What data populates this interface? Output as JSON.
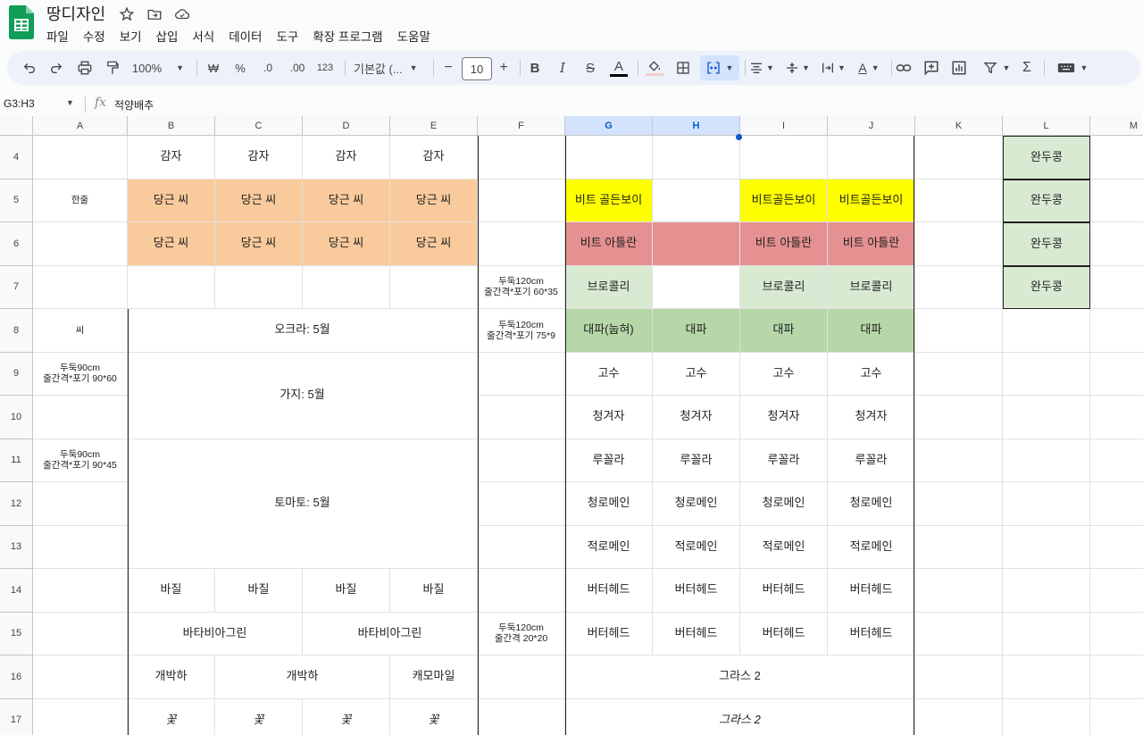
{
  "app": {
    "title": "땅디자인",
    "menus": [
      "파일",
      "수정",
      "보기",
      "삽입",
      "서식",
      "데이터",
      "도구",
      "확장 프로그램",
      "도움말"
    ]
  },
  "toolbar": {
    "zoom": "100%",
    "currency": "₩",
    "percent": "%",
    "dec_decrease": ".0",
    "dec_increase": ".00",
    "format_123": "123",
    "font": "기본값 (...",
    "font_size": "10",
    "minus": "−",
    "plus": "+",
    "bold": "B",
    "italic": "I",
    "strike": "S",
    "text_color": "A",
    "text_color_value": "#000000",
    "fill_color_value": "#f4cccc",
    "sum": "Σ"
  },
  "formula_bar": {
    "name_box": "G3:H3",
    "fx": "fx",
    "content": "적양배추"
  },
  "sheet": {
    "columns": [
      "A",
      "B",
      "C",
      "D",
      "E",
      "F",
      "G",
      "H",
      "I",
      "J",
      "K",
      "L",
      "M"
    ],
    "selected_columns": [
      "G",
      "H"
    ],
    "rows": [
      "4",
      "5",
      "6",
      "7",
      "8",
      "9",
      "10",
      "11",
      "12",
      "13",
      "14",
      "15",
      "16",
      "17"
    ],
    "colors": {
      "orange": "#f9cb9c",
      "yellow": "#ffff00",
      "red": "#e69191",
      "light_green": "#d9ead3",
      "green": "#b6d7a8"
    },
    "cells": [
      {
        "c": "B",
        "r": 4,
        "v": "감자"
      },
      {
        "c": "C",
        "r": 4,
        "v": "감자"
      },
      {
        "c": "D",
        "r": 4,
        "v": "감자"
      },
      {
        "c": "E",
        "r": 4,
        "v": "감자"
      },
      {
        "c": "L",
        "r": 4,
        "v": "완두콩",
        "bg": "light_green"
      },
      {
        "c": "A",
        "r": 5,
        "v": "한줄",
        "small": true
      },
      {
        "c": "B",
        "r": 5,
        "v": "당근 씨",
        "bg": "orange"
      },
      {
        "c": "C",
        "r": 5,
        "v": "당근 씨",
        "bg": "orange"
      },
      {
        "c": "D",
        "r": 5,
        "v": "당근 씨",
        "bg": "orange"
      },
      {
        "c": "E",
        "r": 5,
        "v": "당근 씨",
        "bg": "orange"
      },
      {
        "c": "G",
        "r": 5,
        "v": "비트 골든보이",
        "bg": "yellow"
      },
      {
        "c": "I",
        "r": 5,
        "v": "비트골든보이",
        "bg": "yellow"
      },
      {
        "c": "J",
        "r": 5,
        "v": "비트골든보이",
        "bg": "yellow"
      },
      {
        "c": "L",
        "r": 5,
        "v": "완두콩",
        "bg": "light_green"
      },
      {
        "c": "B",
        "r": 6,
        "v": "당근 씨",
        "bg": "orange"
      },
      {
        "c": "C",
        "r": 6,
        "v": "당근 씨",
        "bg": "orange"
      },
      {
        "c": "D",
        "r": 6,
        "v": "당근 씨",
        "bg": "orange"
      },
      {
        "c": "E",
        "r": 6,
        "v": "당근 씨",
        "bg": "orange"
      },
      {
        "c": "G",
        "r": 6,
        "v": "비트 아틀란",
        "bg": "red"
      },
      {
        "c": "H",
        "r": 6,
        "v": "",
        "bg": "red"
      },
      {
        "c": "I",
        "r": 6,
        "v": "비트 아틀란",
        "bg": "red"
      },
      {
        "c": "J",
        "r": 6,
        "v": "비트 아틀란",
        "bg": "red"
      },
      {
        "c": "L",
        "r": 6,
        "v": "완두콩",
        "bg": "light_green"
      },
      {
        "c": "F",
        "r": 7,
        "v": "두둑120cm\n줄간격*포기 60*35",
        "small": true
      },
      {
        "c": "G",
        "r": 7,
        "v": "브로콜리",
        "bg": "light_green"
      },
      {
        "c": "I",
        "r": 7,
        "v": "브로콜리",
        "bg": "light_green"
      },
      {
        "c": "J",
        "r": 7,
        "v": "브로콜리",
        "bg": "light_green"
      },
      {
        "c": "L",
        "r": 7,
        "v": "완두콩",
        "bg": "light_green"
      },
      {
        "c": "A",
        "r": 8,
        "v": "씨",
        "small": true
      },
      {
        "c": "B",
        "r": 8,
        "span": 4,
        "v": "오크라: 5월"
      },
      {
        "c": "F",
        "r": 8,
        "v": "두둑120cm\n줄간격*포기 75*9",
        "small": true
      },
      {
        "c": "G",
        "r": 8,
        "v": "대파(눕혀)",
        "bg": "green"
      },
      {
        "c": "H",
        "r": 8,
        "v": "대파",
        "bg": "green"
      },
      {
        "c": "I",
        "r": 8,
        "v": "대파",
        "bg": "green"
      },
      {
        "c": "J",
        "r": 8,
        "v": "대파",
        "bg": "green"
      },
      {
        "c": "A",
        "r": 9,
        "v": "두둑90cm\n줄간격*포기 90*60",
        "small": true
      },
      {
        "c": "B",
        "r": 9,
        "span": 4,
        "rspan": 2,
        "v": "가지: 5월"
      },
      {
        "c": "G",
        "r": 9,
        "v": "고수"
      },
      {
        "c": "H",
        "r": 9,
        "v": "고수"
      },
      {
        "c": "I",
        "r": 9,
        "v": "고수"
      },
      {
        "c": "J",
        "r": 9,
        "v": "고수"
      },
      {
        "c": "G",
        "r": 10,
        "v": "청겨자"
      },
      {
        "c": "H",
        "r": 10,
        "v": "청겨자"
      },
      {
        "c": "I",
        "r": 10,
        "v": "청겨자"
      },
      {
        "c": "J",
        "r": 10,
        "v": "청겨자"
      },
      {
        "c": "A",
        "r": 11,
        "v": "두둑90cm\n줄간격*포기 90*45",
        "small": true
      },
      {
        "c": "B",
        "r": 11,
        "span": 4,
        "rspan": 3,
        "v": "토마토: 5월"
      },
      {
        "c": "G",
        "r": 11,
        "v": "루꼴라"
      },
      {
        "c": "H",
        "r": 11,
        "v": "루꼴라"
      },
      {
        "c": "I",
        "r": 11,
        "v": "루꼴라"
      },
      {
        "c": "J",
        "r": 11,
        "v": "루꼴라"
      },
      {
        "c": "G",
        "r": 12,
        "v": "청로메인"
      },
      {
        "c": "H",
        "r": 12,
        "v": "청로메인"
      },
      {
        "c": "I",
        "r": 12,
        "v": "청로메인"
      },
      {
        "c": "J",
        "r": 12,
        "v": "청로메인"
      },
      {
        "c": "G",
        "r": 13,
        "v": "적로메인"
      },
      {
        "c": "H",
        "r": 13,
        "v": "적로메인"
      },
      {
        "c": "I",
        "r": 13,
        "v": "적로메인"
      },
      {
        "c": "J",
        "r": 13,
        "v": "적로메인"
      },
      {
        "c": "B",
        "r": 14,
        "v": "바질"
      },
      {
        "c": "C",
        "r": 14,
        "v": "바질"
      },
      {
        "c": "D",
        "r": 14,
        "v": "바질"
      },
      {
        "c": "E",
        "r": 14,
        "v": "바질"
      },
      {
        "c": "G",
        "r": 14,
        "v": "버터헤드"
      },
      {
        "c": "H",
        "r": 14,
        "v": "버터헤드"
      },
      {
        "c": "I",
        "r": 14,
        "v": "버터헤드"
      },
      {
        "c": "J",
        "r": 14,
        "v": "버터헤드"
      },
      {
        "c": "B",
        "r": 15,
        "span": 2,
        "v": "바타비아그린"
      },
      {
        "c": "D",
        "r": 15,
        "span": 2,
        "v": "바타비아그린"
      },
      {
        "c": "F",
        "r": 15,
        "v": "두둑120cm\n줄간격 20*20",
        "small": true
      },
      {
        "c": "G",
        "r": 15,
        "v": "버터헤드"
      },
      {
        "c": "H",
        "r": 15,
        "v": "버터헤드"
      },
      {
        "c": "I",
        "r": 15,
        "v": "버터헤드"
      },
      {
        "c": "J",
        "r": 15,
        "v": "버터헤드"
      },
      {
        "c": "B",
        "r": 16,
        "v": "개박하"
      },
      {
        "c": "C",
        "r": 16,
        "span": 2,
        "v": "개박하"
      },
      {
        "c": "E",
        "r": 16,
        "v": "캐모마일"
      },
      {
        "c": "G",
        "r": 16,
        "span": 4,
        "v": "그라스 2"
      },
      {
        "c": "B",
        "r": 17,
        "v": "꽃",
        "it": true
      },
      {
        "c": "C",
        "r": 17,
        "v": "꽃",
        "it": true
      },
      {
        "c": "D",
        "r": 17,
        "v": "꽃",
        "it": true
      },
      {
        "c": "E",
        "r": 17,
        "v": "꽃",
        "it": true
      },
      {
        "c": "G",
        "r": 17,
        "span": 4,
        "v": "그라스 2",
        "it": true
      }
    ]
  }
}
